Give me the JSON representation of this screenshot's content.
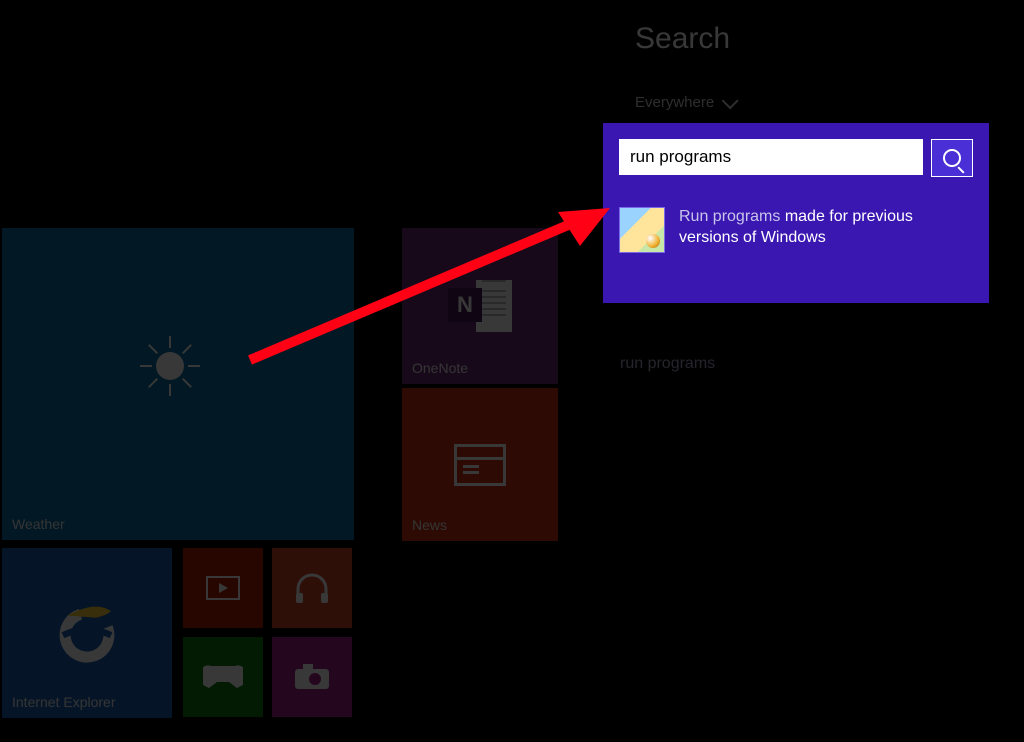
{
  "search": {
    "title": "Search",
    "scope_label": "Everywhere",
    "input_value": "run programs",
    "result_highlight": "Run programs",
    "result_rest": " made for previous versions of Windows",
    "secondary_result": "run programs"
  },
  "tiles": {
    "weather_label": "Weather",
    "onenote_label": "OneNote",
    "onenote_glyph": "N",
    "news_label": "News",
    "ie_label": "Internet Explorer"
  },
  "colors": {
    "highlight_bg": "#3a17b0",
    "arrow": "#ff0014"
  }
}
